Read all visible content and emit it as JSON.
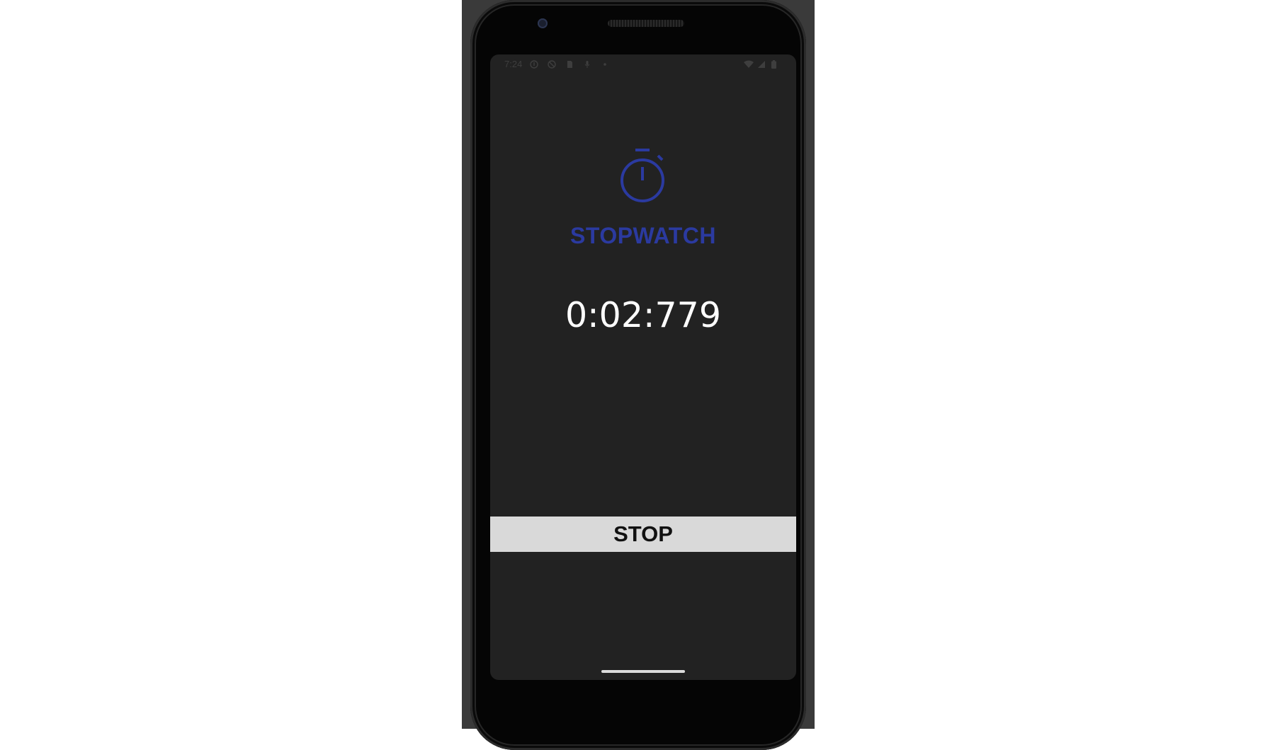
{
  "status_bar": {
    "time": "7:24",
    "left_icons": [
      "info-icon",
      "shield-icon",
      "sim-card-icon",
      "mic-icon",
      "dot-icon"
    ],
    "right_icons": [
      "wifi-icon",
      "cell-signal-icon",
      "battery-icon"
    ]
  },
  "app": {
    "icon": "stopwatch-icon",
    "title": "STOPWATCH",
    "elapsed_time": "0:02:779"
  },
  "controls": {
    "stop_label": "STOP"
  },
  "colors": {
    "accent": "#2b3aa0",
    "screen_background": "#222222",
    "button_background": "#d9d9d9",
    "time_text": "#ffffff"
  }
}
